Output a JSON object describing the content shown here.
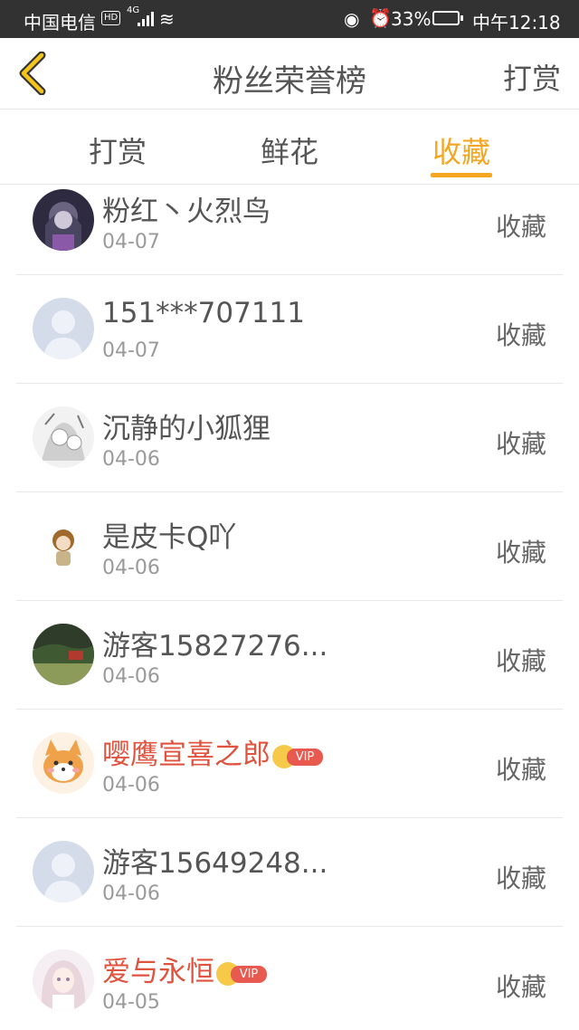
{
  "status_bar": {
    "carrier": "中国电信",
    "hd_badge": "HD",
    "network": "4G",
    "battery_percent": "33%",
    "time": "中午12:18"
  },
  "nav": {
    "title": "粉丝荣誉榜",
    "right_action": "打赏"
  },
  "tabs": [
    {
      "label": "打赏",
      "active": false
    },
    {
      "label": "鲜花",
      "active": false
    },
    {
      "label": "收藏",
      "active": true
    }
  ],
  "accent_color": "#f5a623",
  "vip_name_color": "#e0533e",
  "vip_badge_text": "VIP",
  "fans": [
    {
      "name": "粉红丶火烈鸟",
      "date": "04-07",
      "action": "收藏",
      "vip": false,
      "avatar": "anime-avatar"
    },
    {
      "name": "151***707111",
      "date": "04-07",
      "action": "收藏",
      "vip": false,
      "avatar": "default-avatar"
    },
    {
      "name": "沉静的小狐狸",
      "date": "04-06",
      "action": "收藏",
      "vip": false,
      "avatar": "sketch-avatar"
    },
    {
      "name": "是皮卡Q吖",
      "date": "04-06",
      "action": "收藏",
      "vip": false,
      "avatar": "chibi-avatar"
    },
    {
      "name": "游客15827276...",
      "date": "04-06",
      "action": "收藏",
      "vip": false,
      "avatar": "landscape-avatar"
    },
    {
      "name": "嘤鹰宣喜之郎",
      "date": "04-06",
      "action": "收藏",
      "vip": true,
      "avatar": "shiba-avatar"
    },
    {
      "name": "游客15649248...",
      "date": "04-06",
      "action": "收藏",
      "vip": false,
      "avatar": "default-avatar"
    },
    {
      "name": "爱与永恒",
      "date": "04-05",
      "action": "收藏",
      "vip": true,
      "avatar": "girl-avatar"
    }
  ]
}
